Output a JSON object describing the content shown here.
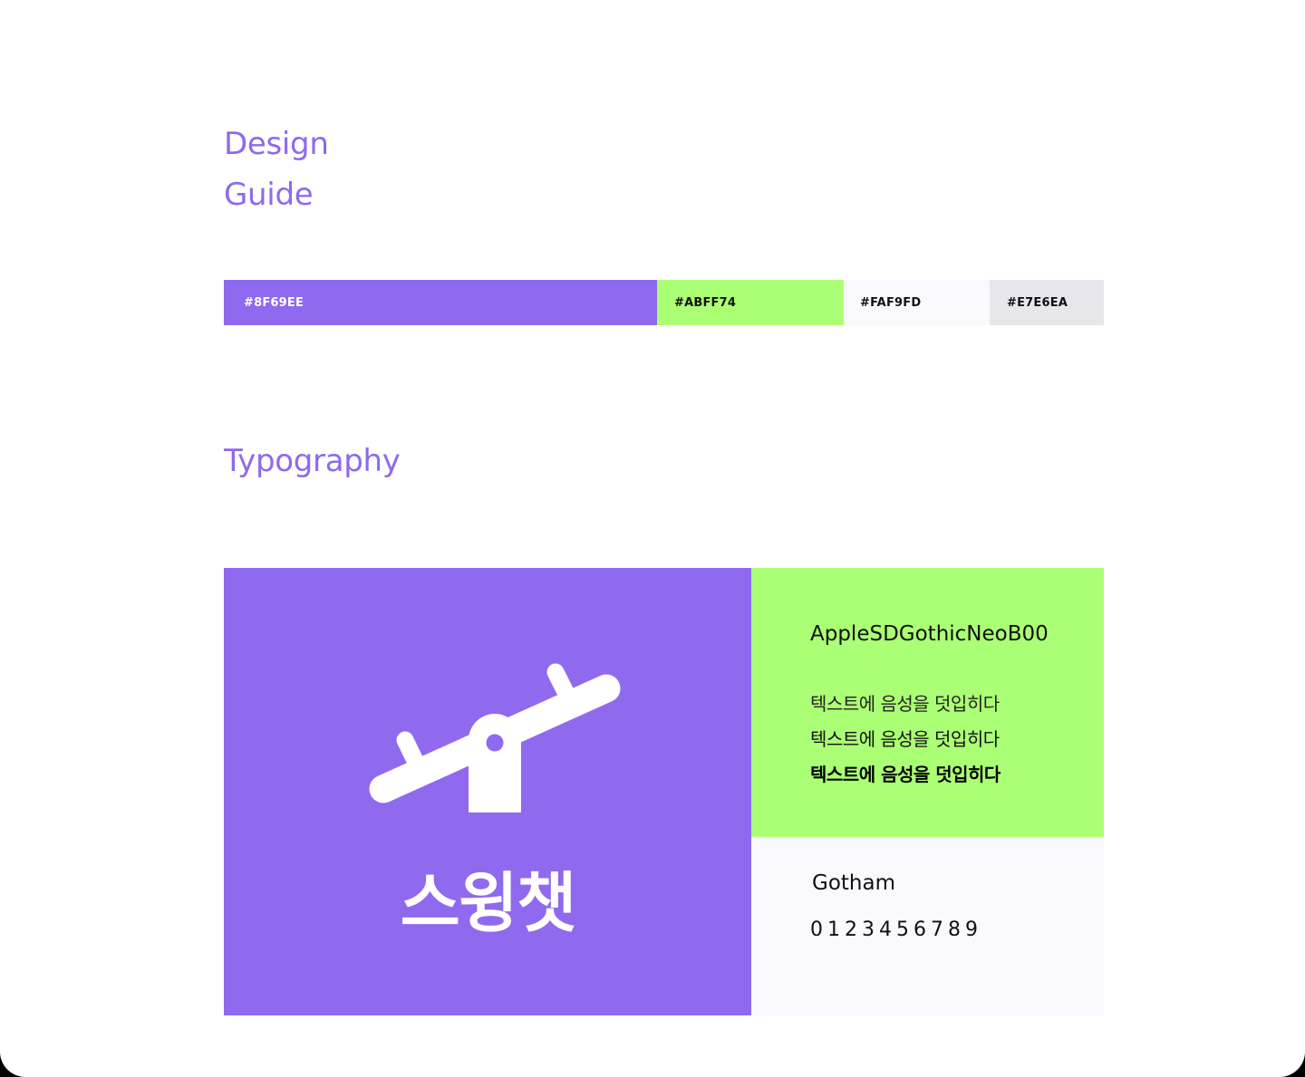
{
  "header": {
    "title_line1": "Design",
    "title_line2": "Guide"
  },
  "palette": [
    {
      "hex": "#8F69EE",
      "label": "#8F69EE",
      "text_color": "#FFFFFF"
    },
    {
      "hex": "#ABFF74",
      "label": "#ABFF74",
      "text_color": "#111111"
    },
    {
      "hex": "#FAF9FD",
      "label": "#FAF9FD",
      "text_color": "#111111"
    },
    {
      "hex": "#E7E6EA",
      "label": "#E7E6EA",
      "text_color": "#111111"
    }
  ],
  "typography": {
    "title": "Typography",
    "logo": {
      "icon": "seesaw-icon",
      "text": "스윙챗",
      "background": "#8F69EE"
    },
    "primary_font": {
      "name": "AppleSDGothicNeoB00",
      "samples": [
        "텍스트에 음성을 덧입히다",
        "텍스트에 음성을 덧입히다",
        "텍스트에 음성을 덧입히다"
      ],
      "background": "#ABFF74"
    },
    "secondary_font": {
      "name": "Gotham",
      "digits": "0123456789",
      "background": "#FAF9FD"
    }
  }
}
